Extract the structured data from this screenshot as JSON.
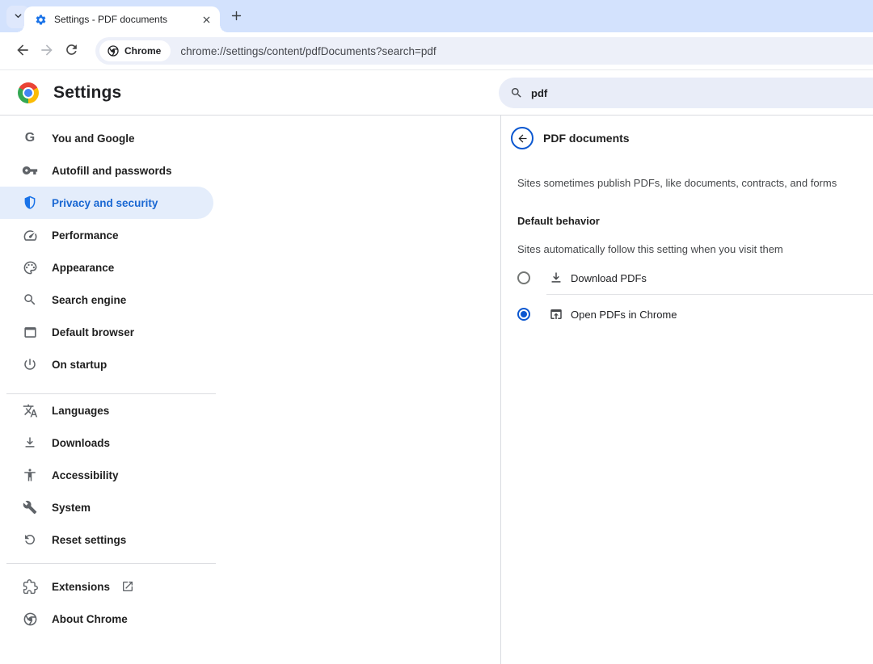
{
  "browser": {
    "tab_title": "Settings - PDF documents",
    "site_chip_label": "Chrome",
    "url": "chrome://settings/content/pdfDocuments?search=pdf"
  },
  "header": {
    "title": "Settings",
    "search_value": "pdf"
  },
  "sidebar": {
    "groups": [
      {
        "items": [
          {
            "label": "You and Google",
            "icon": "google-g-icon"
          },
          {
            "label": "Autofill and passwords",
            "icon": "key-icon"
          },
          {
            "label": "Privacy and security",
            "icon": "shield-icon",
            "selected": true
          },
          {
            "label": "Performance",
            "icon": "speedometer-icon"
          },
          {
            "label": "Appearance",
            "icon": "palette-icon"
          },
          {
            "label": "Search engine",
            "icon": "search-icon"
          },
          {
            "label": "Default browser",
            "icon": "browser-window-icon"
          },
          {
            "label": "On startup",
            "icon": "power-icon"
          }
        ]
      },
      {
        "items": [
          {
            "label": "Languages",
            "icon": "translate-icon"
          },
          {
            "label": "Downloads",
            "icon": "download-icon"
          },
          {
            "label": "Accessibility",
            "icon": "accessibility-icon"
          },
          {
            "label": "System",
            "icon": "wrench-icon"
          },
          {
            "label": "Reset settings",
            "icon": "reset-icon"
          }
        ]
      },
      {
        "items": [
          {
            "label": "Extensions",
            "icon": "puzzle-icon",
            "trailing_icon": "external-link-icon"
          },
          {
            "label": "About Chrome",
            "icon": "chrome-mono-icon"
          }
        ]
      }
    ]
  },
  "content": {
    "page_title": "PDF documents",
    "description": "Sites sometimes publish PDFs, like documents, contracts, and forms",
    "section_title": "Default behavior",
    "section_description": "Sites automatically follow this setting when you visit them",
    "options": [
      {
        "label": "Download PDFs",
        "icon": "download-icon",
        "selected": false
      },
      {
        "label": "Open PDFs in Chrome",
        "icon": "open-in-chrome-icon",
        "selected": true
      }
    ]
  },
  "colors": {
    "tabstrip_bg": "#d3e2fd",
    "accent_blue": "#0b57d0",
    "icon_blue": "#1a73e8",
    "selected_item_bg": "#e4edfb",
    "selected_item_text": "#1967d2",
    "omnibox_bg": "#edf0f9",
    "search_pill_bg": "#e9edf8",
    "icon_gray": "#5f6368"
  }
}
